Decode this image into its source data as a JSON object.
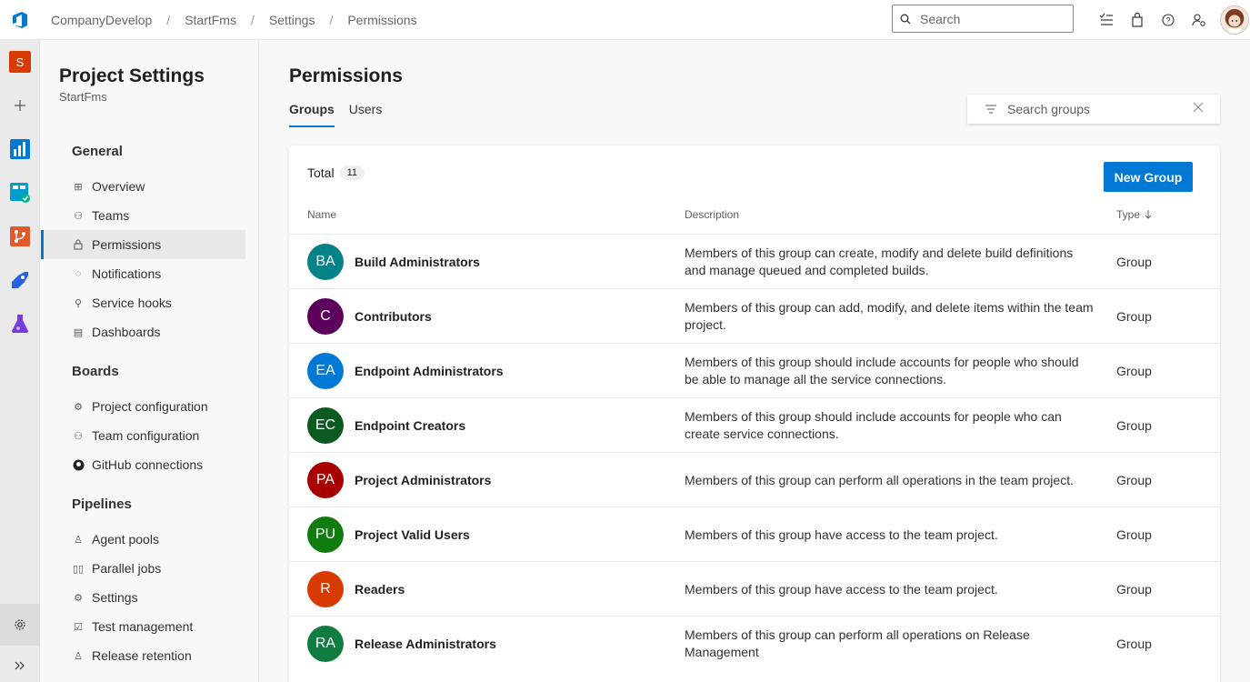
{
  "breadcrumbs": [
    "CompanyDevelop",
    "StartFms",
    "Settings",
    "Permissions"
  ],
  "search": {
    "placeholder": "Search"
  },
  "rail": {
    "project_initial": "S"
  },
  "nav": {
    "title": "Project Settings",
    "subtitle": "StartFms",
    "sections": {
      "general": "General",
      "boards": "Boards",
      "pipelines": "Pipelines"
    },
    "items": {
      "overview": "Overview",
      "teams": "Teams",
      "permissions": "Permissions",
      "notifications": "Notifications",
      "service_hooks": "Service hooks",
      "dashboards": "Dashboards",
      "project_configuration": "Project configuration",
      "team_configuration": "Team configuration",
      "github_connections": "GitHub connections",
      "agent_pools": "Agent pools",
      "parallel_jobs": "Parallel jobs",
      "settings": "Settings",
      "test_management": "Test management",
      "release_retention": "Release retention"
    }
  },
  "main": {
    "title": "Permissions",
    "tabs": [
      "Groups",
      "Users"
    ],
    "group_search_placeholder": "Search groups",
    "total_label": "Total",
    "total_count": "11",
    "new_group_label": "New Group",
    "columns": {
      "name": "Name",
      "description": "Description",
      "type": "Type"
    },
    "groups": [
      {
        "initials": "BA",
        "color": "#038387",
        "name": "Build Administrators",
        "description": "Members of this group can create, modify and delete build definitions and manage queued and completed builds.",
        "type": "Group"
      },
      {
        "initials": "C",
        "color": "#5c005c",
        "name": "Contributors",
        "description": "Members of this group can add, modify, and delete items within the team project.",
        "type": "Group"
      },
      {
        "initials": "EA",
        "color": "#0078d4",
        "name": "Endpoint Administrators",
        "description": "Members of this group should include accounts for people who should be able to manage all the service connections.",
        "type": "Group"
      },
      {
        "initials": "EC",
        "color": "#0b5a22",
        "name": "Endpoint Creators",
        "description": "Members of this group should include accounts for people who can create service connections.",
        "type": "Group"
      },
      {
        "initials": "PA",
        "color": "#a80000",
        "name": "Project Administrators",
        "description": "Members of this group can perform all operations in the team project.",
        "type": "Group"
      },
      {
        "initials": "PU",
        "color": "#107c10",
        "name": "Project Valid Users",
        "description": "Members of this group have access to the team project.",
        "type": "Group"
      },
      {
        "initials": "R",
        "color": "#d83b01",
        "name": "Readers",
        "description": "Members of this group have access to the team project.",
        "type": "Group"
      },
      {
        "initials": "RA",
        "color": "#107c41",
        "name": "Release Administrators",
        "description": "Members of this group can perform all operations on Release Management",
        "type": "Group"
      }
    ]
  },
  "colors": {
    "accent": "#0078d4"
  }
}
